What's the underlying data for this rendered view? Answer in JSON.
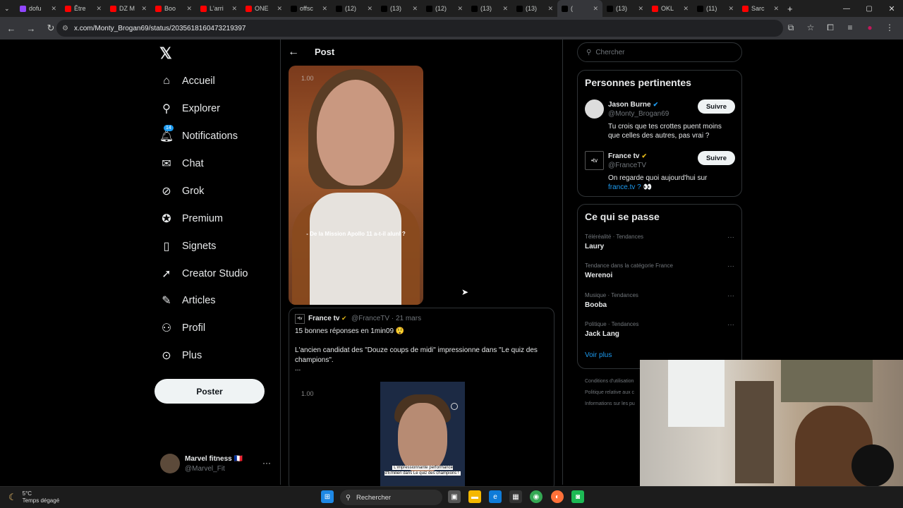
{
  "browser": {
    "tabs": [
      {
        "label": "dofu",
        "color": "#9146ff"
      },
      {
        "label": "Être",
        "color": "#ff0000"
      },
      {
        "label": "DZ M",
        "color": "#ff0000"
      },
      {
        "label": "Boo",
        "color": "#ff0000"
      },
      {
        "label": "L'arri",
        "color": "#ff0000"
      },
      {
        "label": "ONE",
        "color": "#ff0000"
      },
      {
        "label": "offsc",
        "color": "#000000"
      },
      {
        "label": "(12)",
        "color": "#000000"
      },
      {
        "label": "(13)",
        "color": "#000000"
      },
      {
        "label": "(12)",
        "color": "#000000"
      },
      {
        "label": "(13)",
        "color": "#000000"
      },
      {
        "label": "(13)",
        "color": "#000000"
      },
      {
        "label": "(",
        "color": "#000000"
      },
      {
        "label": "(13)",
        "color": "#000000"
      },
      {
        "label": "OKL",
        "color": "#ff0000"
      },
      {
        "label": "(11)",
        "color": "#000000"
      },
      {
        "label": "Sarc",
        "color": "#ff0000"
      }
    ],
    "url": "x.com/Monty_Brogan69/status/2035618160473219397"
  },
  "sidebar": {
    "items": [
      {
        "label": "Accueil"
      },
      {
        "label": "Explorer"
      },
      {
        "label": "Notifications",
        "badge": "14"
      },
      {
        "label": "Chat"
      },
      {
        "label": "Grok"
      },
      {
        "label": "Premium"
      },
      {
        "label": "Signets"
      },
      {
        "label": "Creator Studio"
      },
      {
        "label": "Articles"
      },
      {
        "label": "Profil"
      },
      {
        "label": "Plus"
      }
    ],
    "post_button": "Poster",
    "account": {
      "name": "Marvel fitness 🇫🇷",
      "handle": "@Marvel_Fit"
    }
  },
  "main": {
    "title": "Post",
    "video1": {
      "timestamp": "1.00",
      "subtitle": "- De la Mission Apollo 11 a-t-il alunI ?"
    },
    "quote": {
      "avatar_text": "•tv",
      "name": "France tv",
      "handle_date": "@FranceTV · 21 mars",
      "text1": "15 bonnes réponses en 1min09 😲",
      "text2": "L'ancien candidat des \"Douze coups de midi\" impressionne dans \"Le quiz des champions\".",
      "text3": "...",
      "timestamp": "1.00",
      "video2_subtitle": "L'impressionnante performance d'Emilien dans Le quiz des champions !"
    }
  },
  "right": {
    "search_placeholder": "Chercher",
    "relevant": {
      "title": "Personnes pertinentes",
      "people": [
        {
          "name": "Jason Burne",
          "handle": "@Monty_Brogan69",
          "bio": "Tu crois que tes crottes puent moins que celles des autres, pas vrai ?",
          "link": "",
          "follow": "Suivre"
        },
        {
          "name": "France tv",
          "handle": "@FranceTV",
          "bio": "On regarde quoi aujourd'hui sur ",
          "link": "france.tv ? 👀",
          "follow": "Suivre"
        }
      ]
    },
    "trends": {
      "title": "Ce qui se passe",
      "items": [
        {
          "context": "Téléréalité · Tendances",
          "name": "Laury"
        },
        {
          "context": "Tendance dans la catégorie France",
          "name": "Werenoi"
        },
        {
          "context": "Musique · Tendances",
          "name": "Booba"
        },
        {
          "context": "Politique · Tendances",
          "name": "Jack Lang"
        }
      ],
      "more": "Voir plus"
    },
    "footer": [
      "Conditions d'utilisation",
      "Politique relative aux c",
      "Informations sur les pu"
    ]
  },
  "taskbar": {
    "weather_temp": "5°C",
    "weather_desc": "Temps dégagé",
    "search_label": "Rechercher"
  }
}
